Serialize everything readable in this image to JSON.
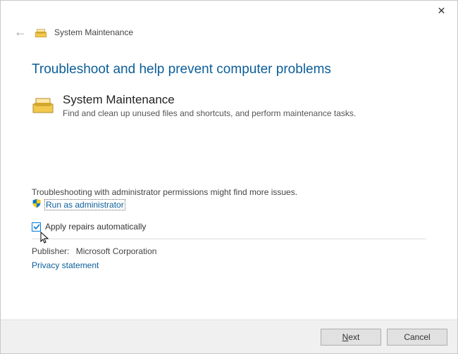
{
  "titlebar": {
    "close": "✕"
  },
  "header": {
    "back_arrow": "←",
    "title": "System Maintenance"
  },
  "main": {
    "heading": "Troubleshoot and help prevent computer problems",
    "section_title": "System Maintenance",
    "section_desc": "Find and clean up unused files and shortcuts, and perform maintenance tasks."
  },
  "admin": {
    "note": "Troubleshooting with administrator permissions might find more issues.",
    "link": "Run as administrator"
  },
  "checkbox": {
    "label": "Apply repairs automatically",
    "checked": true
  },
  "publisher": {
    "label": "Publisher:",
    "value": "Microsoft Corporation"
  },
  "privacy": "Privacy statement",
  "buttons": {
    "next_prefix": "N",
    "next_rest": "ext",
    "cancel": "Cancel"
  }
}
